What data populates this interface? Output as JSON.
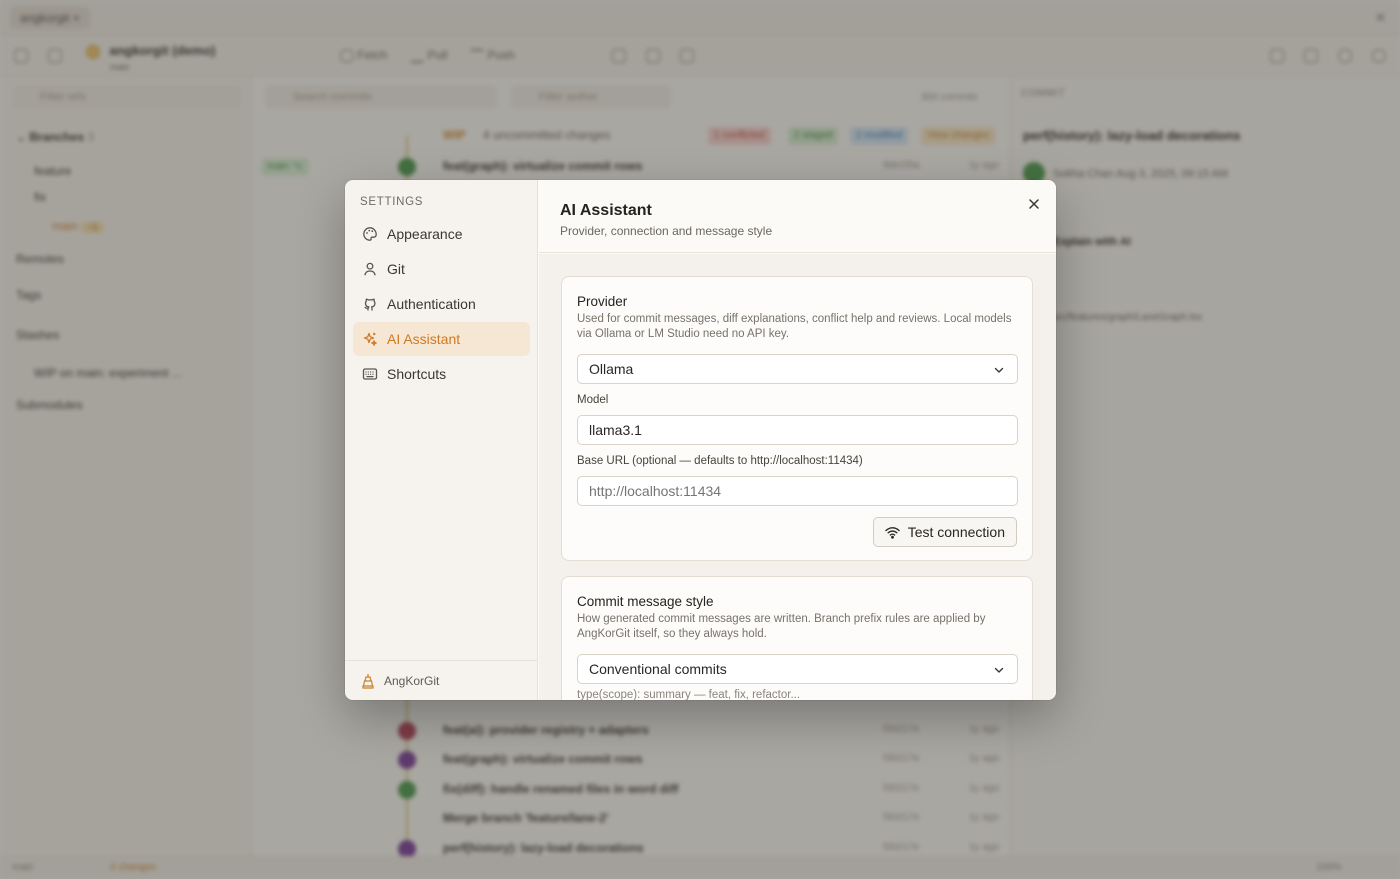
{
  "background": {
    "window_tab": "angkorgit",
    "repo_name": "angkorgit (demo)",
    "repo_sub": "main",
    "toolbar": {
      "fetch": "Fetch",
      "pull": "Pull",
      "push": "Push"
    },
    "sidebar": {
      "filter_placeholder": "Filter refs",
      "branches_label": "Branches",
      "branches_count": "3",
      "items": [
        "feature",
        "fix",
        "main"
      ],
      "remotes_label": "Remotes",
      "tags_label": "Tags",
      "stashes_label": "Stashes",
      "stash_item": "WIP on main: experiment ...",
      "submodules_label": "Submodules"
    },
    "center": {
      "search_placeholder": "Search commits",
      "author_placeholder": "Filter author",
      "count": "300 commits",
      "wip_label": "WIP",
      "wip_text": "4 uncommitted changes",
      "rows": [
        {
          "message": "feat(graph): virtualize commit rows",
          "hash": "9de1f0a",
          "age": "1y ago"
        },
        {
          "message": "feat(ai): provider registry + adapters",
          "hash": "f30217e",
          "age": "1y ago"
        },
        {
          "message": "feat(graph): virtualize commit rows",
          "hash": "f30217e",
          "age": "1y ago"
        },
        {
          "message": "fix(diff): handle renamed files in word diff",
          "hash": "f30217e",
          "age": "1y ago"
        },
        {
          "message": "Merge branch 'feature/lane-2'",
          "hash": "f30217e",
          "age": "1y ago"
        },
        {
          "message": "perf(history): lazy-load decorations",
          "hash": "f30217e",
          "age": "1y ago"
        }
      ]
    },
    "right": {
      "header": "COMMIT",
      "title": "perf(history): lazy-load decorations",
      "author": "Sokha Chan",
      "date": "Aug 3, 2025, 09:15 AM",
      "explain": "Explain with AI",
      "file": "src/features/graph/LaneGraph.tsx"
    },
    "status": {
      "branch": "main",
      "changes": "4 changes",
      "zoom": "100%"
    }
  },
  "settings": {
    "sidebar_title": "SETTINGS",
    "nav": [
      {
        "label": "Appearance",
        "icon": "palette-icon"
      },
      {
        "label": "Git",
        "icon": "user-icon"
      },
      {
        "label": "Authentication",
        "icon": "github-icon"
      },
      {
        "label": "AI Assistant",
        "icon": "sparkles-icon"
      },
      {
        "label": "Shortcuts",
        "icon": "keyboard-icon"
      }
    ],
    "active_nav": "AI Assistant",
    "brand": "AngKorGit",
    "title": "AI Assistant",
    "subtitle": "Provider, connection and message style",
    "provider": {
      "title": "Provider",
      "description": "Used for commit messages, diff explanations, conflict help and reviews. Local models via Ollama or LM Studio need no API key.",
      "selected": "Ollama",
      "model_label": "Model",
      "model_value": "llama3.1",
      "base_url_label": "Base URL (optional — defaults to http://localhost:11434)",
      "base_url_value": "",
      "base_url_placeholder": "http://localhost:11434",
      "test_button": "Test connection"
    },
    "commit_style": {
      "title": "Commit message style",
      "description": "How generated commit messages are written. Branch prefix rules are applied by AngKorGit itself, so they always hold.",
      "selected": "Conventional commits",
      "hint": "type(scope): summary — feat, fix, refactor..."
    }
  },
  "colors": {
    "accent": "#cf7a22",
    "active_nav_bg": "#f5e7d4"
  }
}
